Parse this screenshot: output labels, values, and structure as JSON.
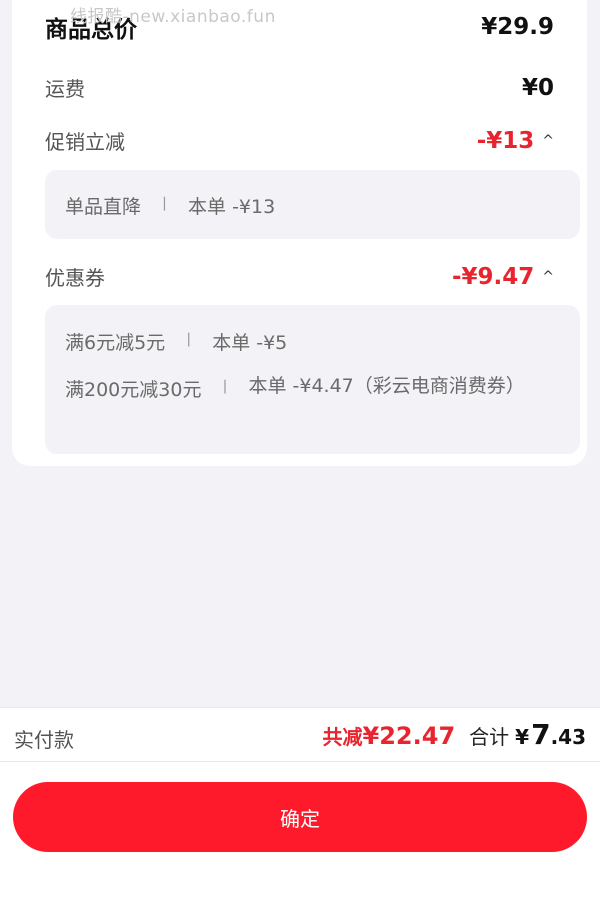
{
  "watermark": "线报酷-new.xianbao.fun",
  "summary": {
    "goods_total_label": "商品总价",
    "goods_total_value": "¥29.9",
    "shipping_label": "运费",
    "shipping_value": "¥0",
    "promo_label": "促销立减",
    "promo_value": "-¥13",
    "promo_details": [
      {
        "name": "单品直降",
        "sep": "丨",
        "desc": "本单 -¥13"
      }
    ],
    "coupon_label": "优惠券",
    "coupon_value": "-¥9.47",
    "coupon_details": [
      {
        "name": "满6元减5元",
        "sep": "丨",
        "desc": "本单 -¥5"
      },
      {
        "name": "满200元减30元",
        "sep": "丨",
        "desc": "本单 -¥4.47（彩云电商消费券）"
      }
    ],
    "caret_glyph": "^"
  },
  "footer": {
    "pay_label": "实付款",
    "discount_label": "共减",
    "discount_value": "¥22.47",
    "total_label": "合计",
    "total_currency": "¥",
    "total_int": "7",
    "total_dec": ".43",
    "confirm_label": "确定"
  },
  "colors": {
    "accent_red": "#ff1a2b",
    "price_red": "#e8242e",
    "background": "#f3f3f7"
  }
}
